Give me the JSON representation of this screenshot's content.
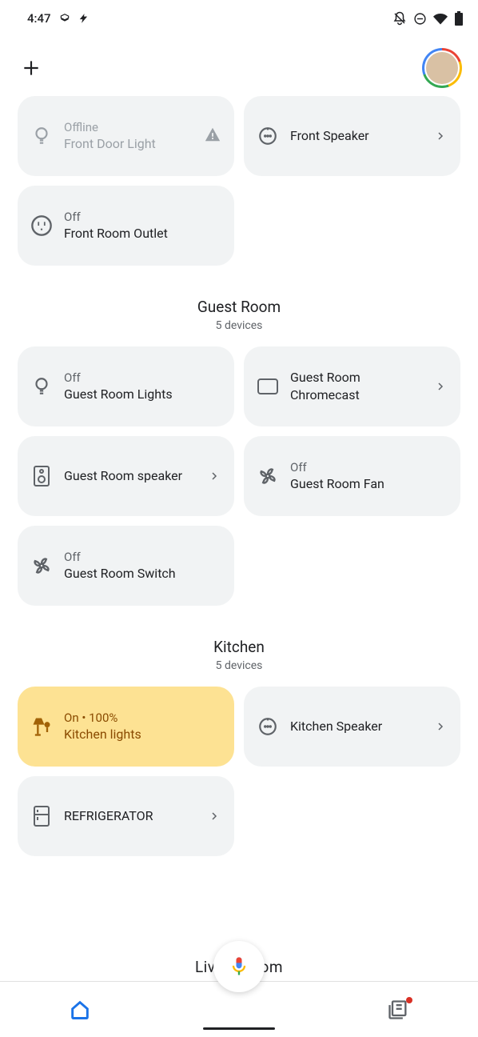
{
  "status_bar": {
    "time": "4:47"
  },
  "rooms": [
    {
      "name": "",
      "count_label": "",
      "devices": [
        {
          "status": "Offline",
          "title": "Front Door Light",
          "icon": "bulb",
          "offline": true,
          "warn": true
        },
        {
          "status": "",
          "title": "Front Speaker",
          "icon": "speaker-mini",
          "chev": true
        },
        {
          "status": "Off",
          "title": "Front Room Outlet",
          "icon": "outlet"
        }
      ]
    },
    {
      "name": "Guest Room",
      "count_label": "5 devices",
      "devices": [
        {
          "status": "Off",
          "title": "Guest Room Lights",
          "icon": "bulb"
        },
        {
          "status": "",
          "title": "Guest Room Chromecast",
          "icon": "cast",
          "chev": true
        },
        {
          "status": "",
          "title": "Guest Room speaker",
          "icon": "speaker",
          "chev": true
        },
        {
          "status": "Off",
          "title": "Guest Room Fan",
          "icon": "fan"
        },
        {
          "status": "Off",
          "title": "Guest Room Switch",
          "icon": "fan"
        }
      ]
    },
    {
      "name": "Kitchen",
      "count_label": "5 devices",
      "devices": [
        {
          "status": "On • 100%",
          "title": "Kitchen lights",
          "icon": "lamp",
          "on": true
        },
        {
          "status": "",
          "title": "Kitchen Speaker",
          "icon": "speaker-mini",
          "chev": true
        },
        {
          "status": "",
          "title": "REFRIGERATOR",
          "icon": "fridge",
          "chev": true
        }
      ]
    }
  ],
  "partial_room_below": "Living Room"
}
